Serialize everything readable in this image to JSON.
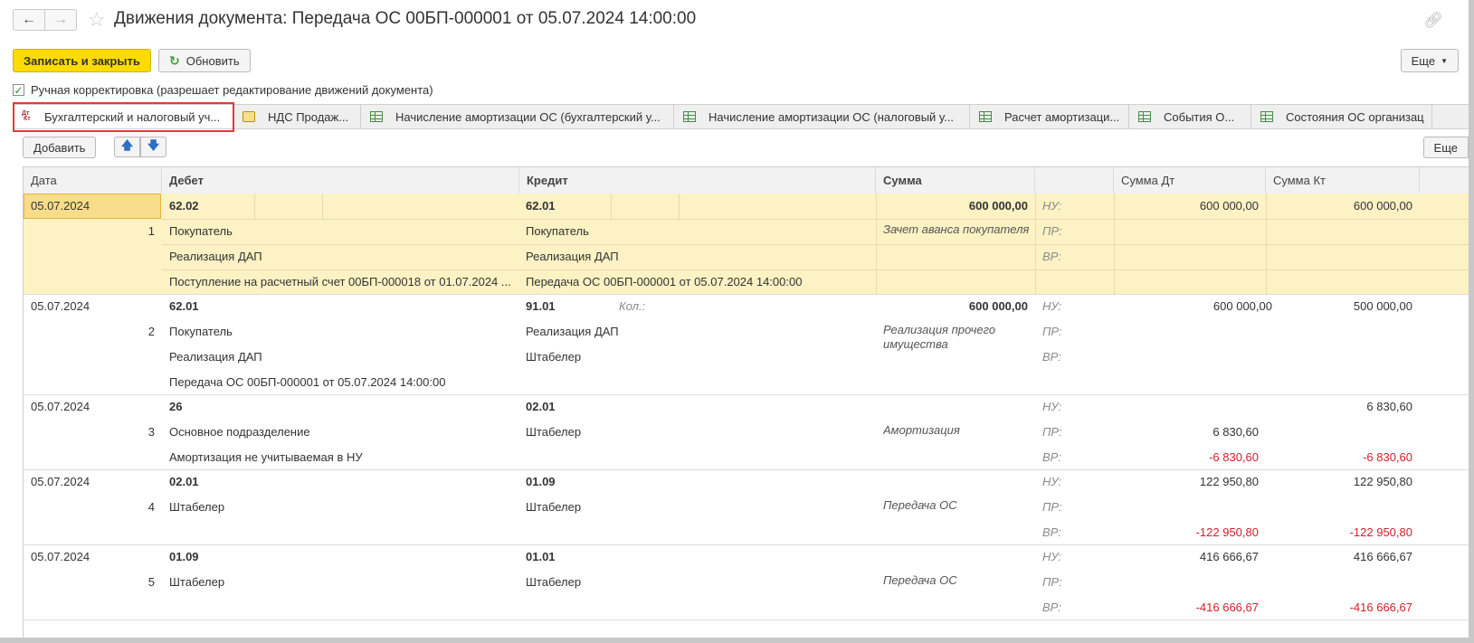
{
  "window": {
    "title": "Движения документа: Передача ОС 00БП-000001 от 05.07.2024 14:00:00"
  },
  "toolbar": {
    "save_close": "Записать и закрыть",
    "refresh": "Обновить",
    "more": "Еще"
  },
  "manual_adjust": {
    "label": "Ручная корректировка (разрешает редактирование движений документа)",
    "checked": true
  },
  "tabs": [
    {
      "label": "Бухгалтерский и налоговый уч...",
      "icon": "dt-kt-icon",
      "active": true
    },
    {
      "label": "НДС Продаж...",
      "icon": "vat-register-icon",
      "active": false
    },
    {
      "label": "Начисление амортизации ОС (бухгалтерский у...",
      "icon": "table-icon",
      "active": false
    },
    {
      "label": "Начисление амортизации ОС (налоговый у...",
      "icon": "table-icon",
      "active": false
    },
    {
      "label": "Расчет амортизаци...",
      "icon": "table-icon",
      "active": false
    },
    {
      "label": "События О...",
      "icon": "table-icon",
      "active": false
    },
    {
      "label": "Состояния ОС организац",
      "icon": "table-icon",
      "active": false
    }
  ],
  "list_bar": {
    "add": "Добавить",
    "more": "Еще"
  },
  "columns": {
    "date": "Дата",
    "debit": "Дебет",
    "credit": "Кредит",
    "amount": "Сумма",
    "type": "",
    "amount_dt": "Сумма Дт",
    "amount_kt": "Сумма Кт"
  },
  "rows": [
    {
      "date": "05.07.2024",
      "num": "1",
      "debit_account": "62.02",
      "debit_sub": [
        "Покупатель",
        "Реализация ДАП",
        "Поступление на расчетный счет 00БП-000018 от 01.07.2024 ..."
      ],
      "credit_account": "62.01",
      "credit_qty": "",
      "credit_sub": [
        "Покупатель",
        "Реализация ДАП",
        "Передача ОС 00БП-000001 от 05.07.2024 14:00:00"
      ],
      "amount": "600 000,00",
      "content": "Зачет аванса покупателя",
      "labels": [
        "НУ:",
        "ПР:",
        "ВР:"
      ],
      "dt": [
        "600 000,00",
        "",
        ""
      ],
      "kt": [
        "600 000,00",
        "",
        ""
      ]
    },
    {
      "date": "05.07.2024",
      "num": "2",
      "debit_account": "62.01",
      "debit_sub": [
        "Покупатель",
        "Реализация ДАП",
        "Передача ОС 00БП-000001 от 05.07.2024 14:00:00"
      ],
      "credit_account": "91.01",
      "credit_qty": "Кол.:",
      "credit_sub": [
        "Реализация ДАП",
        "Штабелер",
        ""
      ],
      "amount": "600 000,00",
      "content": "Реализация прочего имущества",
      "labels": [
        "НУ:",
        "ПР:",
        "ВР:"
      ],
      "dt": [
        "600 000,00",
        "",
        ""
      ],
      "kt": [
        "500 000,00",
        "",
        ""
      ]
    },
    {
      "date": "05.07.2024",
      "num": "3",
      "debit_account": "26",
      "debit_sub": [
        "Основное подразделение",
        "Амортизация не учитываемая в НУ"
      ],
      "credit_account": "02.01",
      "credit_qty": "",
      "credit_sub": [
        "Штабелер",
        ""
      ],
      "amount": "",
      "content": "Амортизация",
      "labels": [
        "НУ:",
        "ПР:",
        "ВР:"
      ],
      "dt": [
        "",
        "6 830,60",
        "-6 830,60"
      ],
      "kt": [
        "6 830,60",
        "",
        "-6 830,60"
      ]
    },
    {
      "date": "05.07.2024",
      "num": "4",
      "debit_account": "02.01",
      "debit_sub": [
        "Штабелер",
        ""
      ],
      "credit_account": "01.09",
      "credit_qty": "",
      "credit_sub": [
        "Штабелер",
        ""
      ],
      "amount": "",
      "content": "Передача ОС",
      "labels": [
        "НУ:",
        "ПР:",
        "ВР:"
      ],
      "dt": [
        "122 950,80",
        "",
        "-122 950,80"
      ],
      "kt": [
        "122 950,80",
        "",
        "-122 950,80"
      ]
    },
    {
      "date": "05.07.2024",
      "num": "5",
      "debit_account": "01.09",
      "debit_sub": [
        "Штабелер",
        ""
      ],
      "credit_account": "01.01",
      "credit_qty": "",
      "credit_sub": [
        "Штабелер",
        ""
      ],
      "amount": "",
      "content": "Передача ОС",
      "labels": [
        "НУ:",
        "ПР:",
        "ВР:"
      ],
      "dt": [
        "416 666,67",
        "",
        "-416 666,67"
      ],
      "kt": [
        "416 666,67",
        "",
        "-416 666,67"
      ]
    }
  ]
}
